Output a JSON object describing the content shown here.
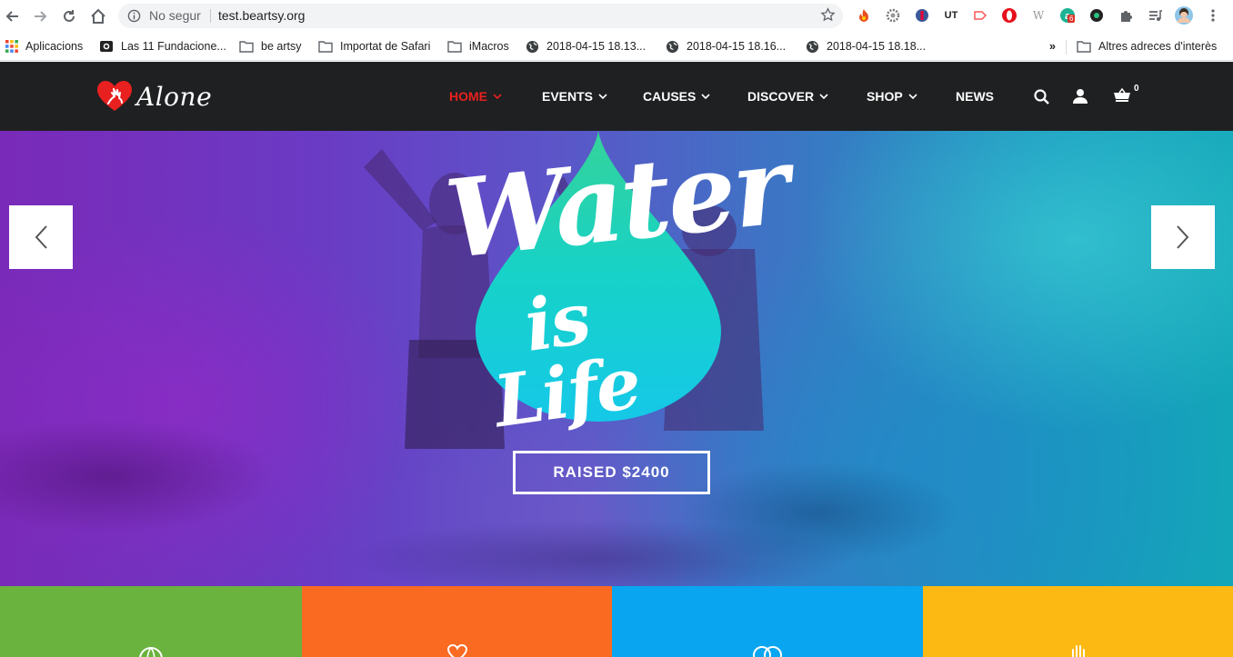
{
  "browser": {
    "status": "No segur",
    "url": "test.beartsy.org",
    "bookmarks": [
      {
        "label": "Aplicacions",
        "icon": "apps-grid-icon"
      },
      {
        "label": "Las 11 Fundacione...",
        "icon": "camera-icon"
      },
      {
        "label": "be artsy",
        "icon": "folder-icon"
      },
      {
        "label": "Importat de Safari",
        "icon": "folder-icon"
      },
      {
        "label": "iMacros",
        "icon": "folder-icon"
      },
      {
        "label": "2018-04-15 18.13...",
        "icon": "globe-icon"
      },
      {
        "label": "2018-04-15 18.16...",
        "icon": "globe-icon"
      },
      {
        "label": "2018-04-15 18.18...",
        "icon": "globe-icon"
      }
    ],
    "more_bookmarks": "»",
    "other_bookmarks": "Altres adreces d'interès",
    "extension_badge": "6"
  },
  "site": {
    "logo_text": "Alone",
    "menu": [
      {
        "label": "HOME",
        "active": true,
        "dropdown": true
      },
      {
        "label": "EVENTS",
        "active": false,
        "dropdown": true
      },
      {
        "label": "CAUSES",
        "active": false,
        "dropdown": true
      },
      {
        "label": "DISCOVER",
        "active": false,
        "dropdown": true
      },
      {
        "label": "SHOP",
        "active": false,
        "dropdown": true
      },
      {
        "label": "NEWS",
        "active": false,
        "dropdown": false
      }
    ],
    "cart_count": "0",
    "accent_color": "#e8201f"
  },
  "hero": {
    "title_line1": "Water",
    "title_line2": "is Life",
    "cta_label": "RAISED $2400"
  },
  "tiles": [
    {
      "color": "#6ab33f",
      "icon": "globe-icon"
    },
    {
      "color": "#fb6a21",
      "icon": "heart-icon"
    },
    {
      "color": "#0aa5f0",
      "icon": "hearts-icon"
    },
    {
      "color": "#fdb913",
      "icon": "hand-icon"
    }
  ]
}
